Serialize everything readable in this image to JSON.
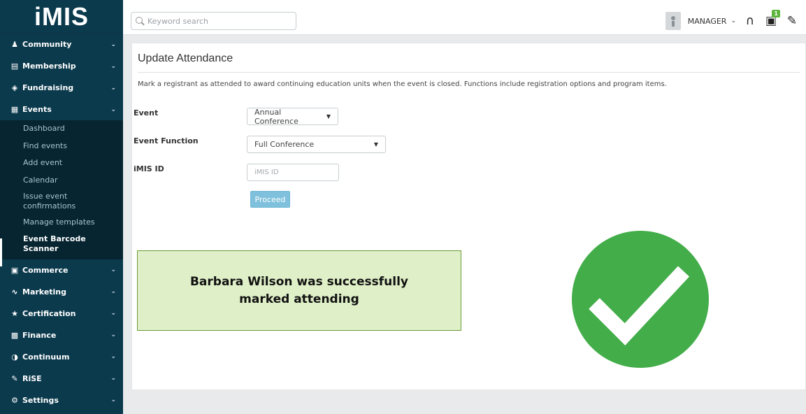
{
  "app": {
    "logo": "iMIS"
  },
  "colors": {
    "sidebar_bg": "#0b3a4d",
    "success_green": "#42ad49",
    "success_box_bg": "#dff0c8",
    "button_blue": "#7fc1dc"
  },
  "sidebar": {
    "items": [
      {
        "label": "Community",
        "icon": "community-icon"
      },
      {
        "label": "Membership",
        "icon": "membership-icon"
      },
      {
        "label": "Fundraising",
        "icon": "fundraising-icon"
      },
      {
        "label": "Events",
        "icon": "calendar-icon",
        "expanded": true
      },
      {
        "label": "Commerce",
        "icon": "cart-icon"
      },
      {
        "label": "Marketing",
        "icon": "chart-line-icon"
      },
      {
        "label": "Certification",
        "icon": "ribbon-icon"
      },
      {
        "label": "Finance",
        "icon": "money-icon"
      },
      {
        "label": "Continuum",
        "icon": "pie-icon"
      },
      {
        "label": "RiSE",
        "icon": "edit-icon"
      },
      {
        "label": "Settings",
        "icon": "gear-icon"
      }
    ],
    "events_sub": [
      {
        "label": "Dashboard"
      },
      {
        "label": "Find events"
      },
      {
        "label": "Add event"
      },
      {
        "label": "Calendar"
      },
      {
        "label": "Issue event confirmations"
      },
      {
        "label": "Manage templates"
      },
      {
        "label": "Event Barcode Scanner",
        "active": true
      }
    ]
  },
  "topbar": {
    "search_placeholder": "Keyword search",
    "user": "MANAGER",
    "cart_count": "1"
  },
  "main": {
    "title": "Update Attendance",
    "description": "Mark a registrant as attended to award continuing education units when the event is closed. Functions include registration options and program items.",
    "event_label": "Event",
    "event_value": "Annual Conference",
    "function_label": "Event Function",
    "function_value": "Full Conference",
    "id_label": "iMIS ID",
    "id_placeholder": "iMIS ID",
    "proceed": "Proceed",
    "success_message": "Barbara Wilson was successfully marked attending"
  }
}
